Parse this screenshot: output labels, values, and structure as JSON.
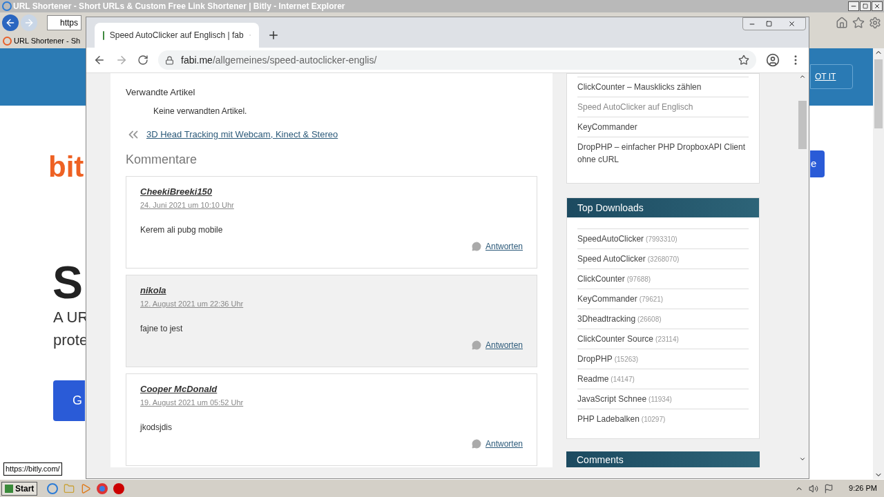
{
  "ie": {
    "title": "URL Shortener - Short URLs & Custom Free Link Shortener | Bitly - Internet Explorer",
    "address": "https",
    "tab": "URL Shortener - Sh",
    "page": {
      "logo": "bit",
      "heading": "S",
      "lines": [
        "A UR",
        "prote"
      ],
      "cta": "G",
      "got_it": "OT IT",
      "right_button": "e"
    },
    "status_url": "https://bitly.com/"
  },
  "chrome": {
    "tab": "Speed AutoClicker auf Englisch | fab",
    "url_domain": "fabi.me",
    "url_path": "/allgemeines/speed-autoclicker-englis/"
  },
  "article": {
    "related_heading": "Verwandte Artikel",
    "related_none": "Keine verwandten Artikel.",
    "prev_link": "3D Head Tracking mit Webcam, Kinect & Stereo",
    "comments_heading": "Kommentare",
    "comments": [
      {
        "author": "CheekiBreeki150",
        "date": "24. Juni 2021 um 10:10 Uhr",
        "text": "Kerem ali pubg mobile",
        "reply": "Antworten",
        "shaded": false
      },
      {
        "author": "nikola",
        "date": "12. August 2021 um 22:36 Uhr",
        "text": "fajne to jest",
        "reply": "Antworten",
        "shaded": true
      },
      {
        "author": "Cooper McDonald",
        "date": "19. August 2021 um 05:52 Uhr",
        "text": "jkodsjdis",
        "reply": "Antworten",
        "shaded": false
      }
    ]
  },
  "sidebar": {
    "recent": [
      {
        "label": "ClickCounter – Mausklicks zählen",
        "selected": false
      },
      {
        "label": "Speed AutoClicker auf Englisch",
        "selected": true
      },
      {
        "label": "KeyCommander",
        "selected": false
      },
      {
        "label": "DropPHP – einfacher PHP DropboxAPI Client ohne cURL",
        "selected": false
      }
    ],
    "top_downloads": {
      "title": "Top Downloads",
      "items": [
        {
          "name": "SpeedAutoClicker",
          "count": "(7993310)"
        },
        {
          "name": "Speed AutoClicker",
          "count": "(3268070)"
        },
        {
          "name": "ClickCounter",
          "count": "(97688)"
        },
        {
          "name": "KeyCommander",
          "count": "(79621)"
        },
        {
          "name": "3Dheadtracking",
          "count": "(26608)"
        },
        {
          "name": "ClickCounter Source",
          "count": "(23114)"
        },
        {
          "name": "DropPHP",
          "count": "(15263)"
        },
        {
          "name": "Readme",
          "count": "(14147)"
        },
        {
          "name": "JavaScript Schnee",
          "count": "(11934)"
        },
        {
          "name": "PHP Ladebalken",
          "count": "(10297)"
        }
      ]
    },
    "comments_title": "Comments"
  },
  "taskbar": {
    "start": "Start",
    "clock": "9:26 PM"
  }
}
